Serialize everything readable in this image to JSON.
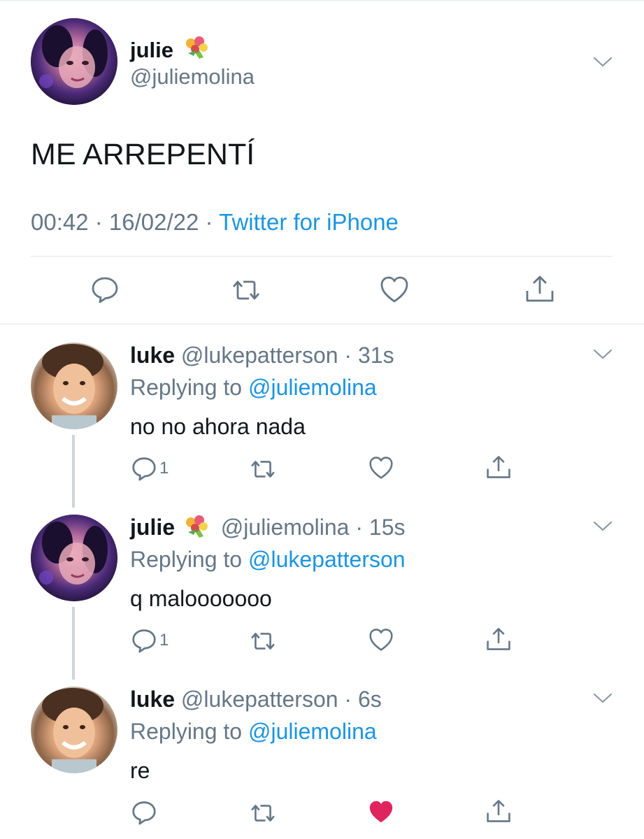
{
  "tweet": {
    "display_name": "julie",
    "name_emoji": "bouquet-emoji",
    "handle": "@juliemolina",
    "text": "ME ARREPENTÍ",
    "time": "00:42",
    "date": "16/02/22",
    "source": "Twitter for iPhone",
    "separator": " · ",
    "icons": [
      "reply-icon",
      "retweet-icon",
      "like-icon",
      "share-icon"
    ]
  },
  "replies": [
    {
      "display_name": "luke",
      "handle": "@lukepatterson",
      "age": "31s",
      "replying_prefix": "Replying to ",
      "replying_to": "@juliemolina",
      "text": "no no ahora nada",
      "reply_count": "1",
      "liked": false
    },
    {
      "display_name": "julie",
      "handle": "@juliemolina",
      "age": "15s",
      "replying_prefix": "Replying to ",
      "replying_to": "@lukepatterson",
      "text": "q malooooooo",
      "reply_count": "1",
      "liked": false
    },
    {
      "display_name": "luke",
      "handle": "@lukepatterson",
      "age": "6s",
      "replying_prefix": "Replying to ",
      "replying_to": "@juliemolina",
      "text": "re",
      "reply_count": "",
      "liked": true
    }
  ],
  "colors": {
    "accent": "#1b95e0",
    "secondary_text": "#657786",
    "like": "#e0245e",
    "divider": "#e1e8ed"
  }
}
